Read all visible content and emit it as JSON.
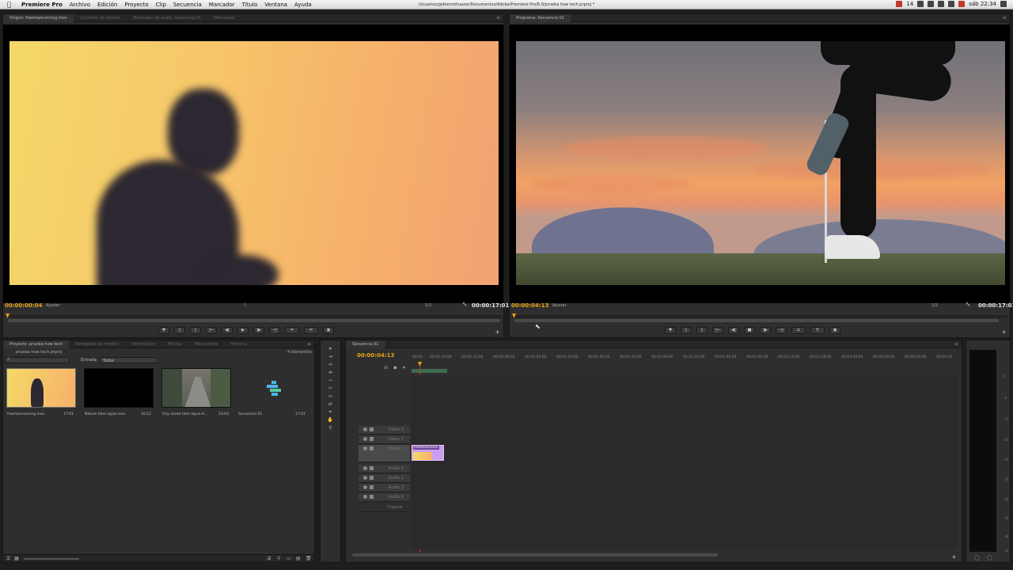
{
  "menubar": {
    "app_name": "Premiere Pro",
    "items": [
      "Archivo",
      "Edición",
      "Proyecto",
      "Clip",
      "Secuencia",
      "Marcador",
      "Título",
      "Ventana",
      "Ayuda"
    ],
    "path": "/Usuarios/gobiernohuazar/Documentos/Adobe/Premiere Pro/6.0/prueba how tech.prproj *",
    "status_badge": "14",
    "clock": "sáb 22:34"
  },
  "source_monitor": {
    "tabs": [
      "Origen: freemanrunning.mov",
      "Controles de efectos",
      "Mezclador de audio: Secuencia 01",
      "Metadatos"
    ],
    "timecode_in": "00:00:00:04",
    "fit": "Ajustar",
    "resolution": "1/2",
    "timecode_duration": "00:00:17:01"
  },
  "program_monitor": {
    "tabs": [
      "Programa: Secuencia 01"
    ],
    "timecode_in": "00:00:04:13",
    "fit": "Ajustar",
    "resolution": "1/2",
    "timecode_duration": "00:00:17:01"
  },
  "transport": {
    "source": [
      "▼",
      "{",
      "}",
      "|←",
      "◀|",
      "▶",
      "|▶",
      "→|",
      "⇋",
      "⇌",
      "▣"
    ],
    "program": [
      "▼",
      "{",
      "}",
      "|←",
      "◀|",
      "■",
      "|▶",
      "→|",
      "⇊",
      "⇈",
      "▣"
    ]
  },
  "project_panel": {
    "tabs": [
      "Proyecto: prueba how tech",
      "Navegador de medios",
      "Información",
      "Efectos",
      "Marcadores",
      "Historial"
    ],
    "project_file": "prueba how tech.prproj",
    "item_count": "4 elementos",
    "filter_label": "Entrada:",
    "filter_value": "Todos",
    "items": [
      {
        "name": "freemanrunning.mov",
        "duration": "17:01"
      },
      {
        "name": "Nature time lapse.mov",
        "duration": "10:12"
      },
      {
        "name": "City street time lapse-H...",
        "duration": "23:03"
      },
      {
        "name": "Secuencia 01",
        "duration": "17:01"
      }
    ]
  },
  "timeline": {
    "tab": "Secuencia 01",
    "timecode": "00:00:04:13",
    "ruler": [
      "00:00",
      "00:00:16:00",
      "00:00:32:00",
      "00:00:48:00",
      "00:01:04:00",
      "00:01:20:00",
      "00:01:36:00",
      "00:01:52:00",
      "00:02:08:00",
      "00:02:24:00",
      "00:02:40:00",
      "00:02:56:00",
      "00:03:12:00",
      "00:03:28:00",
      "00:03:44:00",
      "00:04:00:00",
      "00:04:16:00",
      "00:04:32"
    ],
    "tracks": [
      "Vídeo 3",
      "Vídeo 2",
      "Vídeo 1",
      "Audio 1",
      "Audio 2",
      "Audio 3",
      "Audio 4",
      "Original"
    ],
    "clip_label": "freemanrunni"
  },
  "audio_meter": {
    "ticks": [
      "0",
      "-6",
      "-12",
      "-18",
      "-24",
      "-30",
      "-36",
      "-42",
      "-48",
      "-54"
    ]
  },
  "colors": {
    "timecode": "#e8a317",
    "playhead": "#d03020",
    "clip": "#c9a0f0"
  }
}
